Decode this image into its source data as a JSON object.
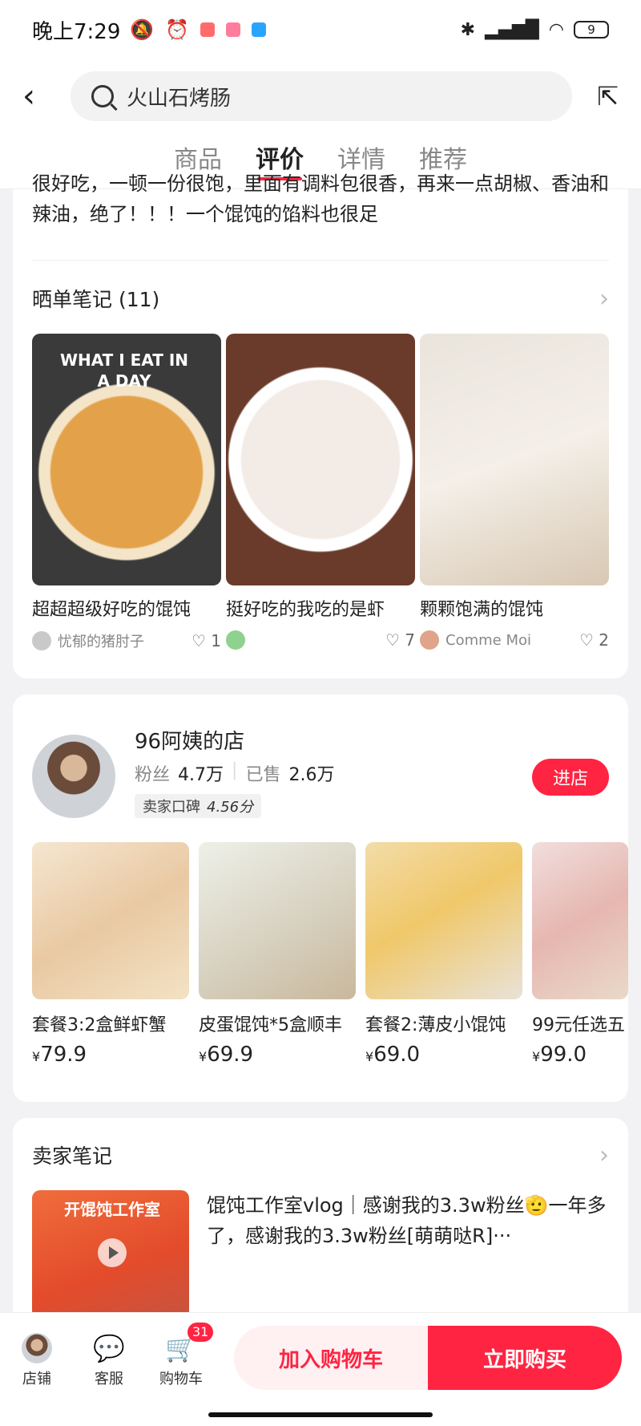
{
  "status": {
    "time": "晚上7:29",
    "battery": "9",
    "app_colors": [
      "#ff6b6b",
      "#ff7c9c",
      "#2aa5ff"
    ]
  },
  "header": {
    "search_text": "火山石烤肠"
  },
  "tabs": [
    {
      "label": "商品"
    },
    {
      "label": "评价"
    },
    {
      "label": "详情"
    },
    {
      "label": "推荐"
    }
  ],
  "review": {
    "text": "很好吃，一顿一份很饱，里面有调料包很香，再来一点胡椒、香油和辣油，绝了！！！一个馄饨的馅料也很足"
  },
  "notes_section": {
    "title": "晒单笔记 (11)",
    "items": [
      {
        "title": "超超超级好吃的馄饨",
        "user": "忧郁的猪肘子",
        "likes": "1",
        "img_text": "WHAT I EAT IN A DAY"
      },
      {
        "title": "挺好吃的我吃的是虾",
        "user": "",
        "likes": "7"
      },
      {
        "title": "颗颗饱满的馄饨",
        "user": "Comme Moi",
        "likes": "2"
      }
    ]
  },
  "shop": {
    "name": "96阿姨的店",
    "fans_label": "粉丝",
    "fans": "4.7万",
    "sold_label": "已售",
    "sold": "2.6万",
    "rating_label": "卖家口碑",
    "rating": "4.56分",
    "enter_label": "进店",
    "products": [
      {
        "title": "套餐3:2盒鲜虾蟹",
        "price": "79.9"
      },
      {
        "title": "皮蛋馄饨*5盒顺丰",
        "price": "69.9"
      },
      {
        "title": "套餐2:薄皮小馄饨",
        "price": "69.0"
      },
      {
        "title": "99元任选五",
        "price": "99.0"
      }
    ],
    "currency": "¥"
  },
  "seller_notes": {
    "title": "卖家笔记",
    "text": "馄饨工作室vlog｜感谢我的3.3w粉丝🫡一年多了，感谢我的3.3w粉丝[萌萌哒R]···",
    "thumb_text": "开馄饨工作室"
  },
  "bottom_bar": {
    "store": "店铺",
    "service": "客服",
    "cart": "购物车",
    "cart_count": "31",
    "add_to_cart": "加入购物车",
    "buy_now": "立即购买"
  },
  "accent_color": "#ff2442"
}
